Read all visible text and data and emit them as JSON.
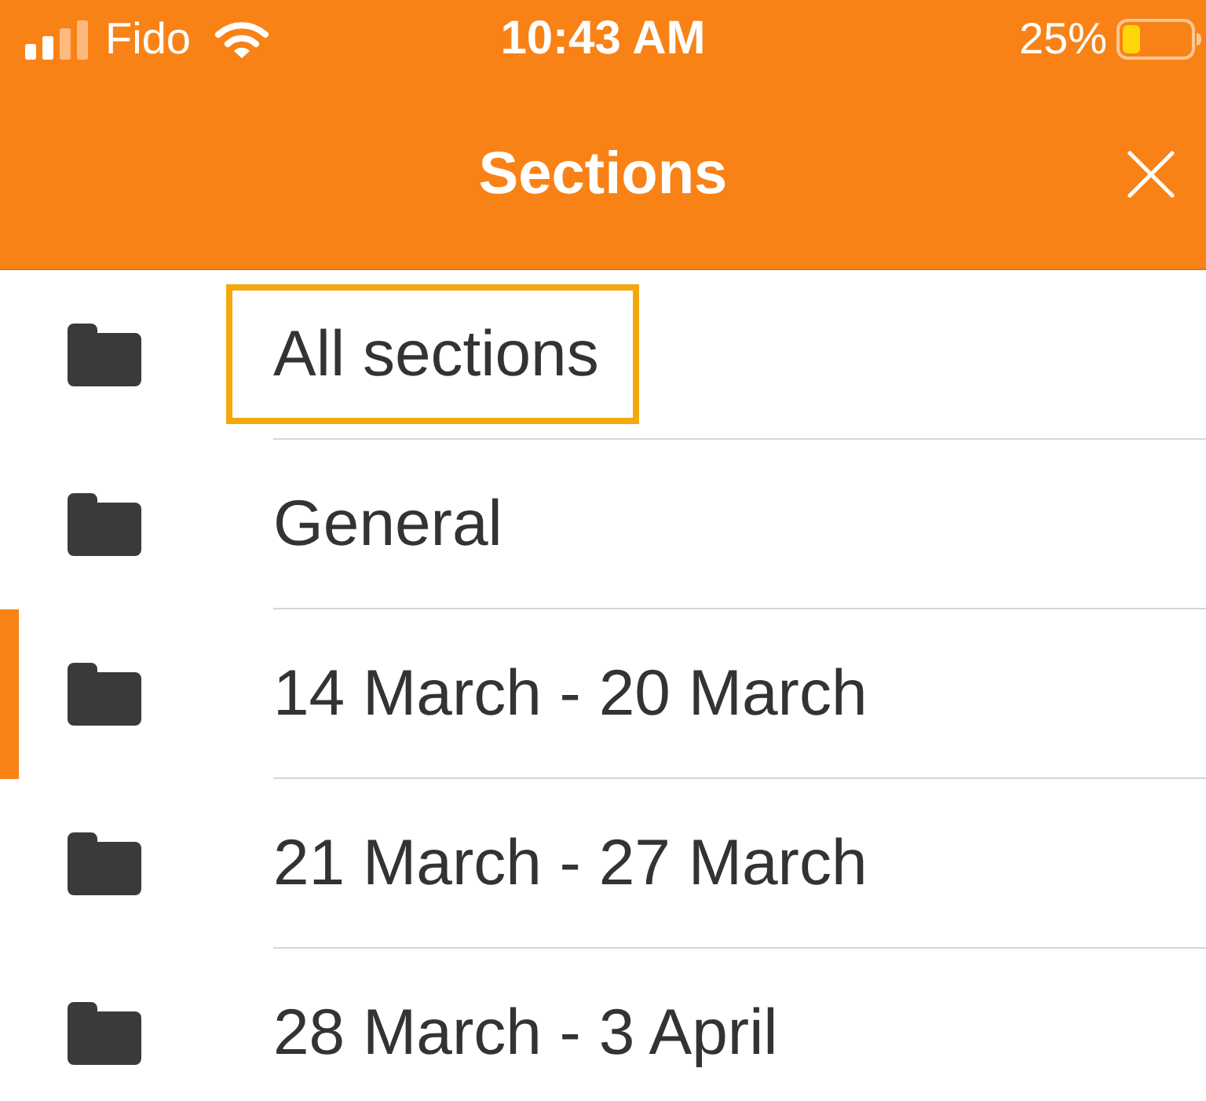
{
  "status_bar": {
    "carrier": "Fido",
    "time": "10:43 AM",
    "battery": "25%"
  },
  "header": {
    "title": "Sections"
  },
  "items": [
    {
      "label": "All sections",
      "focused": true,
      "current": false
    },
    {
      "label": "General",
      "focused": false,
      "current": false
    },
    {
      "label": "14 March - 20 March",
      "focused": false,
      "current": true
    },
    {
      "label": "21 March - 27 March",
      "focused": false,
      "current": false
    },
    {
      "label": "28 March - 3 April",
      "focused": false,
      "current": false
    }
  ]
}
